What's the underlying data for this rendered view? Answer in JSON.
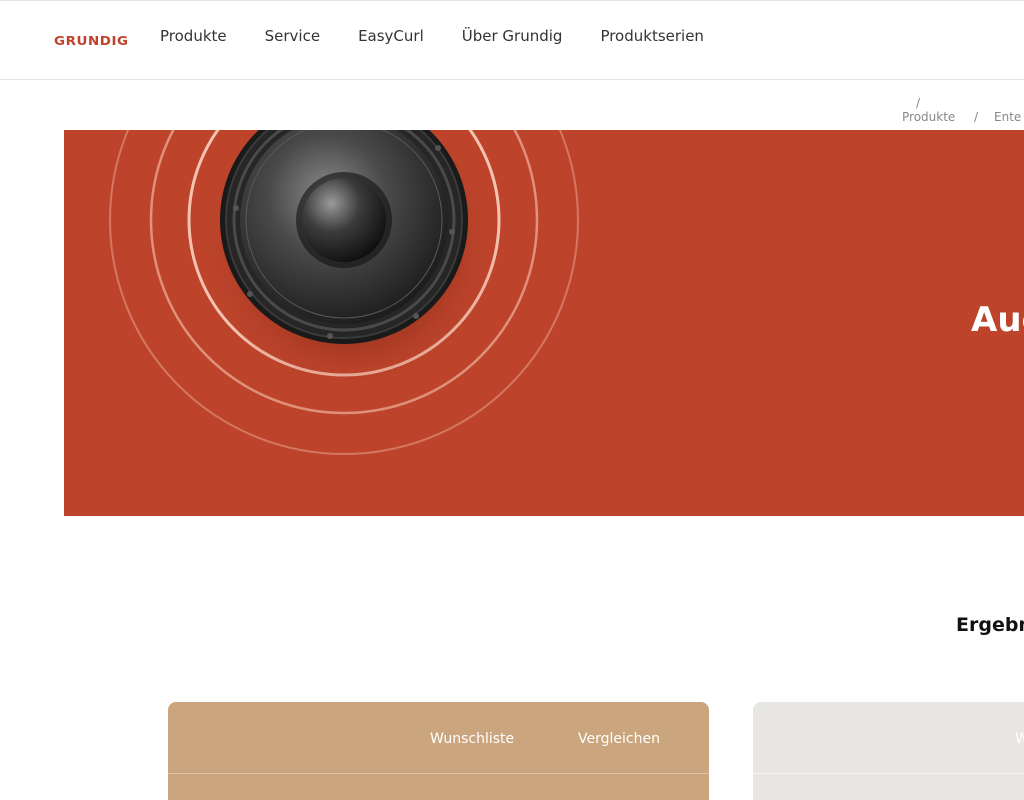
{
  "brand": {
    "logo_text": "GRUNDIG",
    "accent": "#c0432b"
  },
  "nav": {
    "items": [
      {
        "label": "Produkte"
      },
      {
        "label": "Service"
      },
      {
        "label": "EasyCurl"
      },
      {
        "label": "Über Grundig"
      },
      {
        "label": "Produktserien"
      }
    ]
  },
  "breadcrumb": {
    "sep": "/",
    "items": [
      {
        "label": "Produkte"
      },
      {
        "label": "Ente"
      }
    ]
  },
  "hero": {
    "title": "Auc",
    "background": "#bd442b",
    "image": "speaker-with-sound-rings"
  },
  "results": {
    "label": "Ergebn"
  },
  "cards": [
    {
      "wishlist": "Wunschliste",
      "compare": "Vergleichen",
      "color": "#cba57d"
    },
    {
      "wishlist": "W",
      "color": "#e8e6e2"
    }
  ]
}
